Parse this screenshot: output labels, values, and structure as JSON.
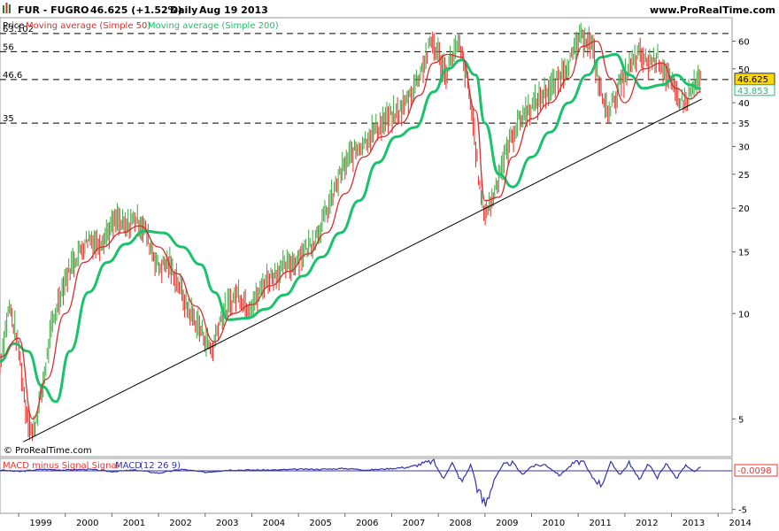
{
  "header": {
    "icon": "candlestick-icon",
    "symbol": "FUR - FUGRO",
    "price_change": "46.625 (+1.52%)",
    "period": "Daily",
    "date": "Aug 19 2013",
    "site": "www.ProRealTime.com"
  },
  "legend": {
    "price": "Price",
    "ma50": "Moving average (Simple 50)",
    "ma200": "Moving average (Simple 200)"
  },
  "copyright": "© ProRealTime.com",
  "colors": {
    "price_up": "#4caf50",
    "price_down": "#e53935",
    "ma50": "#d32f2f",
    "ma200": "#19c26b",
    "trendline": "#000000",
    "macd": "#3333aa",
    "signal_diff": "#e53935",
    "last_price_badge": "#ffd700",
    "ma_badge": "#19c26b"
  },
  "chart_data": [
    {
      "type": "line",
      "scale": "log",
      "ylim": [
        3.9,
        70
      ],
      "xlim": [
        1998.6,
        2014.3
      ],
      "x_ticks": [
        "1999",
        "2000",
        "2001",
        "2002",
        "2003",
        "2004",
        "2005",
        "2006",
        "2007",
        "2008",
        "2009",
        "2010",
        "2011",
        "2012",
        "2013",
        "2014"
      ],
      "y_ticks": [
        5,
        10,
        15,
        20,
        25,
        30,
        35,
        40,
        50,
        60
      ],
      "reference_lines": [
        {
          "label": "63.102",
          "value": 63.102
        },
        {
          "label": "56",
          "value": 56
        },
        {
          "label": "46.6",
          "value": 46.6
        },
        {
          "label": "35",
          "value": 35
        }
      ],
      "last_value_label": "46.625",
      "ma_value_label": "43.853",
      "trendline": {
        "x": [
          1999.1,
          2013.65
        ],
        "y": [
          4.3,
          41
        ]
      },
      "series": [
        {
          "name": "Price",
          "x": [
            1998.6,
            1998.8,
            1999.0,
            1999.15,
            1999.3,
            1999.5,
            1999.7,
            1999.9,
            2000.1,
            2000.3,
            2000.5,
            2000.7,
            2000.9,
            2001.1,
            2001.3,
            2001.5,
            2001.7,
            2001.8,
            2002.0,
            2002.2,
            2002.4,
            2002.6,
            2002.8,
            2003.0,
            2003.15,
            2003.3,
            2003.5,
            2003.7,
            2003.9,
            2004.1,
            2004.3,
            2004.5,
            2004.7,
            2004.9,
            2005.1,
            2005.3,
            2005.5,
            2005.7,
            2005.9,
            2006.1,
            2006.3,
            2006.5,
            2006.7,
            2006.9,
            2007.1,
            2007.3,
            2007.5,
            2007.7,
            2007.85,
            2008.0,
            2008.15,
            2008.3,
            2008.45,
            2008.6,
            2008.75,
            2008.9,
            2009.0,
            2009.15,
            2009.3,
            2009.5,
            2009.7,
            2009.9,
            2010.1,
            2010.3,
            2010.5,
            2010.7,
            2010.9,
            2011.0,
            2011.15,
            2011.3,
            2011.45,
            2011.6,
            2011.75,
            2011.9,
            2012.1,
            2012.3,
            2012.5,
            2012.7,
            2012.9,
            2013.1,
            2013.3,
            2013.5,
            2013.63
          ],
          "values": [
            7.2,
            10.5,
            8.0,
            5.4,
            4.5,
            6.0,
            9.0,
            11.5,
            13.5,
            15.0,
            16.5,
            15.8,
            17.0,
            18.5,
            17.5,
            18.8,
            17.5,
            16.0,
            13.5,
            14.0,
            12.5,
            10.5,
            9.5,
            8.5,
            7.8,
            9.5,
            10.5,
            11.5,
            10.5,
            11.0,
            12.5,
            13.0,
            13.5,
            14.0,
            15.0,
            16.0,
            18.0,
            21.0,
            25.0,
            28.0,
            30.0,
            32.0,
            34.0,
            36.0,
            37.0,
            40.0,
            45.0,
            52.0,
            60.0,
            55.0,
            48.0,
            55.0,
            58.0,
            48.0,
            35.0,
            22.0,
            19.5,
            21.0,
            25.0,
            30.0,
            35.0,
            38.0,
            40.0,
            43.0,
            45.0,
            50.0,
            55.0,
            60.0,
            62.0,
            58.0,
            45.0,
            38.0,
            40.0,
            45.0,
            50.0,
            55.0,
            52.0,
            54.0,
            48.0,
            42.0,
            40.0,
            45.0,
            46.625
          ]
        },
        {
          "name": "Moving average (Simple 50)",
          "x": [
            1998.6,
            1999.0,
            1999.3,
            1999.6,
            2000.0,
            2000.4,
            2000.8,
            2001.2,
            2001.6,
            2002.0,
            2002.4,
            2002.8,
            2003.2,
            2003.6,
            2004.0,
            2004.4,
            2004.8,
            2005.2,
            2005.6,
            2006.0,
            2006.4,
            2006.8,
            2007.2,
            2007.6,
            2007.9,
            2008.2,
            2008.5,
            2008.8,
            2009.0,
            2009.3,
            2009.6,
            2010.0,
            2010.4,
            2010.8,
            2011.1,
            2011.4,
            2011.7,
            2012.0,
            2012.4,
            2012.8,
            2013.1,
            2013.4,
            2013.63
          ],
          "values": [
            7.5,
            8.5,
            5.0,
            6.5,
            10.0,
            14.0,
            15.5,
            17.0,
            17.8,
            15.5,
            13.0,
            10.5,
            8.3,
            10.0,
            10.6,
            12.0,
            13.2,
            14.8,
            17.0,
            22.0,
            28.0,
            32.0,
            35.0,
            42.0,
            52.0,
            55.0,
            54.0,
            38.0,
            21.0,
            21.5,
            28.0,
            36.0,
            40.0,
            47.0,
            58.0,
            60.0,
            47.0,
            40.0,
            50.0,
            52.0,
            44.0,
            41.0,
            43.0
          ]
        },
        {
          "name": "Moving average (Simple 200)",
          "x": [
            1998.6,
            1998.9,
            1999.2,
            1999.5,
            1999.8,
            2000.1,
            2000.5,
            2000.9,
            2001.3,
            2001.7,
            2002.1,
            2002.5,
            2002.9,
            2003.2,
            2003.5,
            2003.9,
            2004.3,
            2004.7,
            2005.1,
            2005.5,
            2005.9,
            2006.3,
            2006.7,
            2007.1,
            2007.5,
            2007.9,
            2008.2,
            2008.5,
            2008.8,
            2009.0,
            2009.3,
            2009.6,
            2010.0,
            2010.4,
            2010.8,
            2011.2,
            2011.5,
            2011.8,
            2012.1,
            2012.4,
            2012.8,
            2013.1,
            2013.4,
            2013.63
          ],
          "values": [
            7.3,
            8.2,
            7.8,
            6.2,
            5.6,
            7.8,
            11.5,
            14.0,
            15.8,
            17.2,
            17.0,
            15.5,
            13.8,
            11.5,
            9.6,
            9.7,
            10.3,
            11.3,
            12.8,
            14.5,
            17.0,
            21.0,
            27.0,
            32.0,
            34.0,
            43.0,
            50.0,
            53.0,
            48.0,
            35.0,
            25.0,
            23.0,
            28.0,
            33.0,
            40.0,
            48.0,
            54.0,
            55.0,
            48.0,
            44.0,
            45.0,
            48.0,
            45.0,
            43.853
          ]
        }
      ]
    },
    {
      "type": "line",
      "title": "MACD minus Signal Signal",
      "macd_label": "MACD",
      "macd_params": "(12 26 9)",
      "ylim": [
        -5.5,
        1.6
      ],
      "y_ticks": [
        -5
      ],
      "last_value_label": "-0.0098",
      "series": [
        {
          "name": "MACD (12 26 9)",
          "x": [
            1998.6,
            1999.0,
            1999.5,
            2000.0,
            2000.5,
            2001.0,
            2001.5,
            2002.0,
            2002.5,
            2003.0,
            2003.5,
            2004.0,
            2004.5,
            2005.0,
            2005.5,
            2006.0,
            2006.5,
            2007.0,
            2007.4,
            2007.7,
            2007.9,
            2008.1,
            2008.3,
            2008.5,
            2008.7,
            2008.85,
            2009.0,
            2009.2,
            2009.4,
            2009.6,
            2009.8,
            2010.0,
            2010.3,
            2010.6,
            2010.9,
            2011.1,
            2011.3,
            2011.5,
            2011.7,
            2011.9,
            2012.1,
            2012.3,
            2012.5,
            2012.7,
            2012.9,
            2013.1,
            2013.3,
            2013.5,
            2013.63
          ],
          "values": [
            0.1,
            -0.1,
            0.2,
            0.1,
            0.2,
            -0.1,
            0.1,
            -0.3,
            0.2,
            -0.2,
            0.1,
            0.1,
            0.1,
            0.2,
            0.2,
            0.3,
            0.1,
            0.3,
            0.5,
            1.0,
            1.2,
            -1.0,
            1.0,
            -1.5,
            0.8,
            -2.5,
            -4.5,
            -1.0,
            0.8,
            1.0,
            -0.5,
            0.6,
            0.8,
            -0.6,
            1.0,
            1.2,
            -0.8,
            -1.8,
            1.0,
            -0.5,
            1.1,
            -1.2,
            0.9,
            -0.8,
            1.0,
            -1.0,
            0.7,
            -0.2,
            0.6
          ]
        }
      ]
    }
  ]
}
